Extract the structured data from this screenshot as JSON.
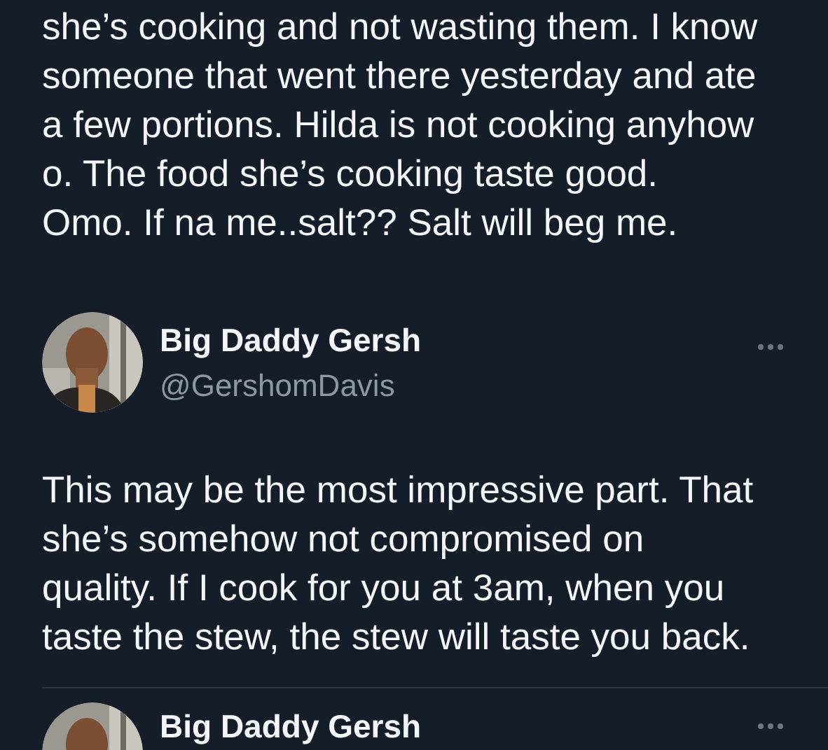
{
  "tweets": [
    {
      "lines": [
        "she’s cooking and not wasting them. I know",
        "someone that went there yesterday and ate",
        "a few portions. Hilda is not cooking anyhow",
        "o. The food she’s cooking taste good.",
        "Omo. If na me..salt?? Salt will beg me."
      ]
    },
    {
      "author": {
        "name": "Big Daddy Gersh",
        "handle": "@GershomDavis"
      },
      "lines": [
        "This may be the most impressive part. That",
        "she’s somehow not compromised on",
        "quality. If I cook for you at 3am, when you",
        "taste the stew, the stew will taste you back."
      ]
    },
    {
      "author": {
        "name": "Big Daddy Gersh"
      }
    }
  ]
}
